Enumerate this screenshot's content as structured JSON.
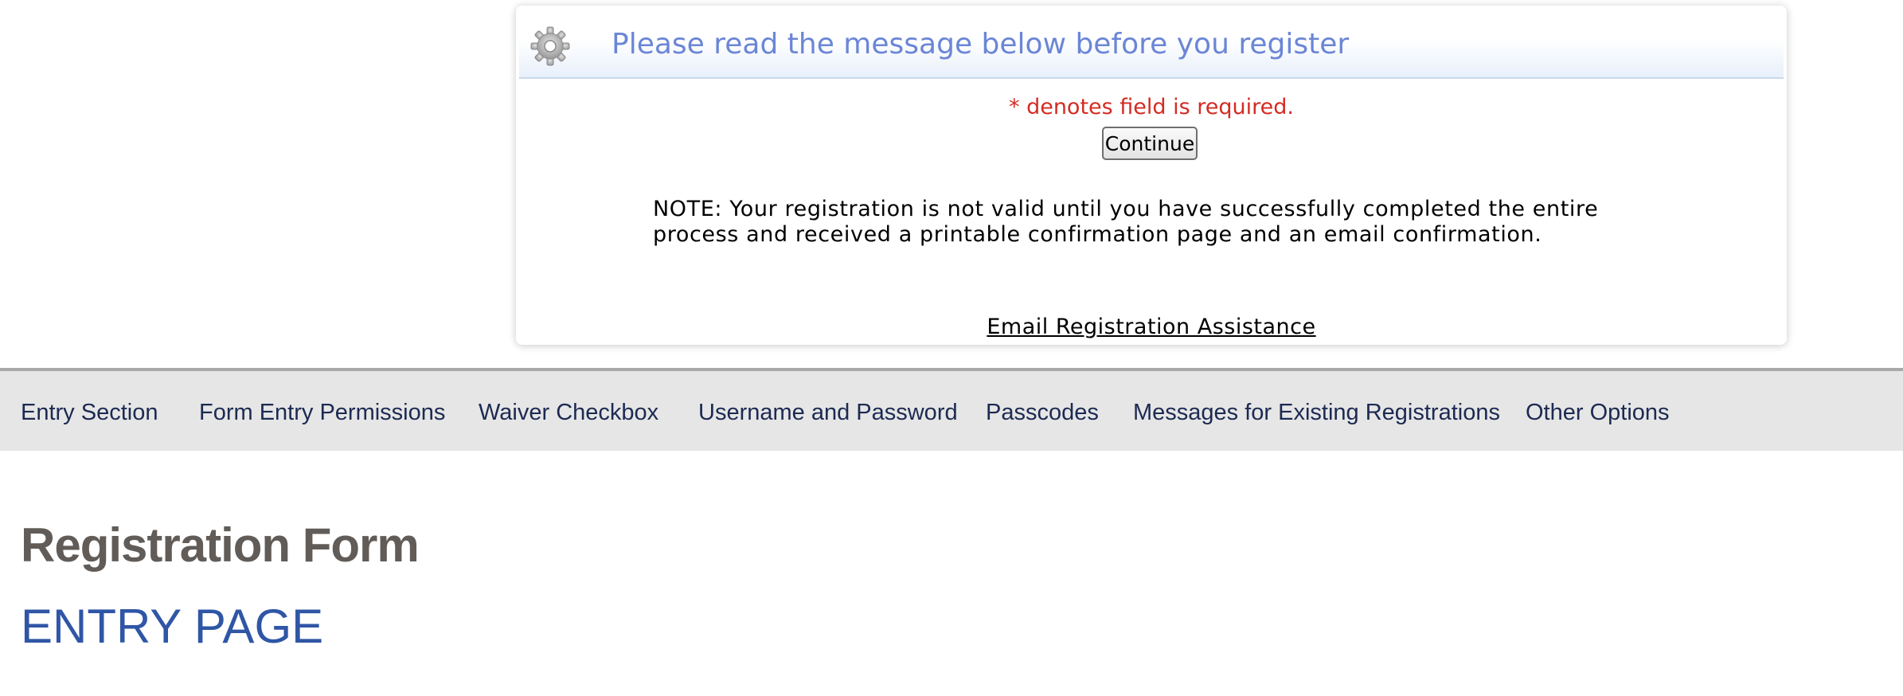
{
  "notice": {
    "title": "Please read the message below before you register",
    "required_note": "* denotes field is required.",
    "continue_label": "Continue",
    "note_text": "NOTE: Your registration is not valid until you have successfully completed the entire process and received a printable confirmation page and an email confirmation.",
    "assist_link": "Email Registration Assistance",
    "icon": "gear-icon"
  },
  "nav": {
    "items": [
      {
        "label": "Entry Section"
      },
      {
        "label": "Form Entry Permissions"
      },
      {
        "label": "Waiver Checkbox"
      },
      {
        "label": "Username and Password"
      },
      {
        "label": "Passcodes"
      },
      {
        "label": "Messages for Existing Registrations"
      },
      {
        "label": "Other Options"
      }
    ]
  },
  "main": {
    "title": "Registration Form",
    "subtitle": "ENTRY PAGE"
  },
  "colors": {
    "title_blue": "#6b86d6",
    "required_red": "#d42b22",
    "nav_bg": "#e6e6e6",
    "nav_text": "#1c2a52",
    "heading_gray": "#615c58",
    "subheading_blue": "#2f56a6"
  }
}
